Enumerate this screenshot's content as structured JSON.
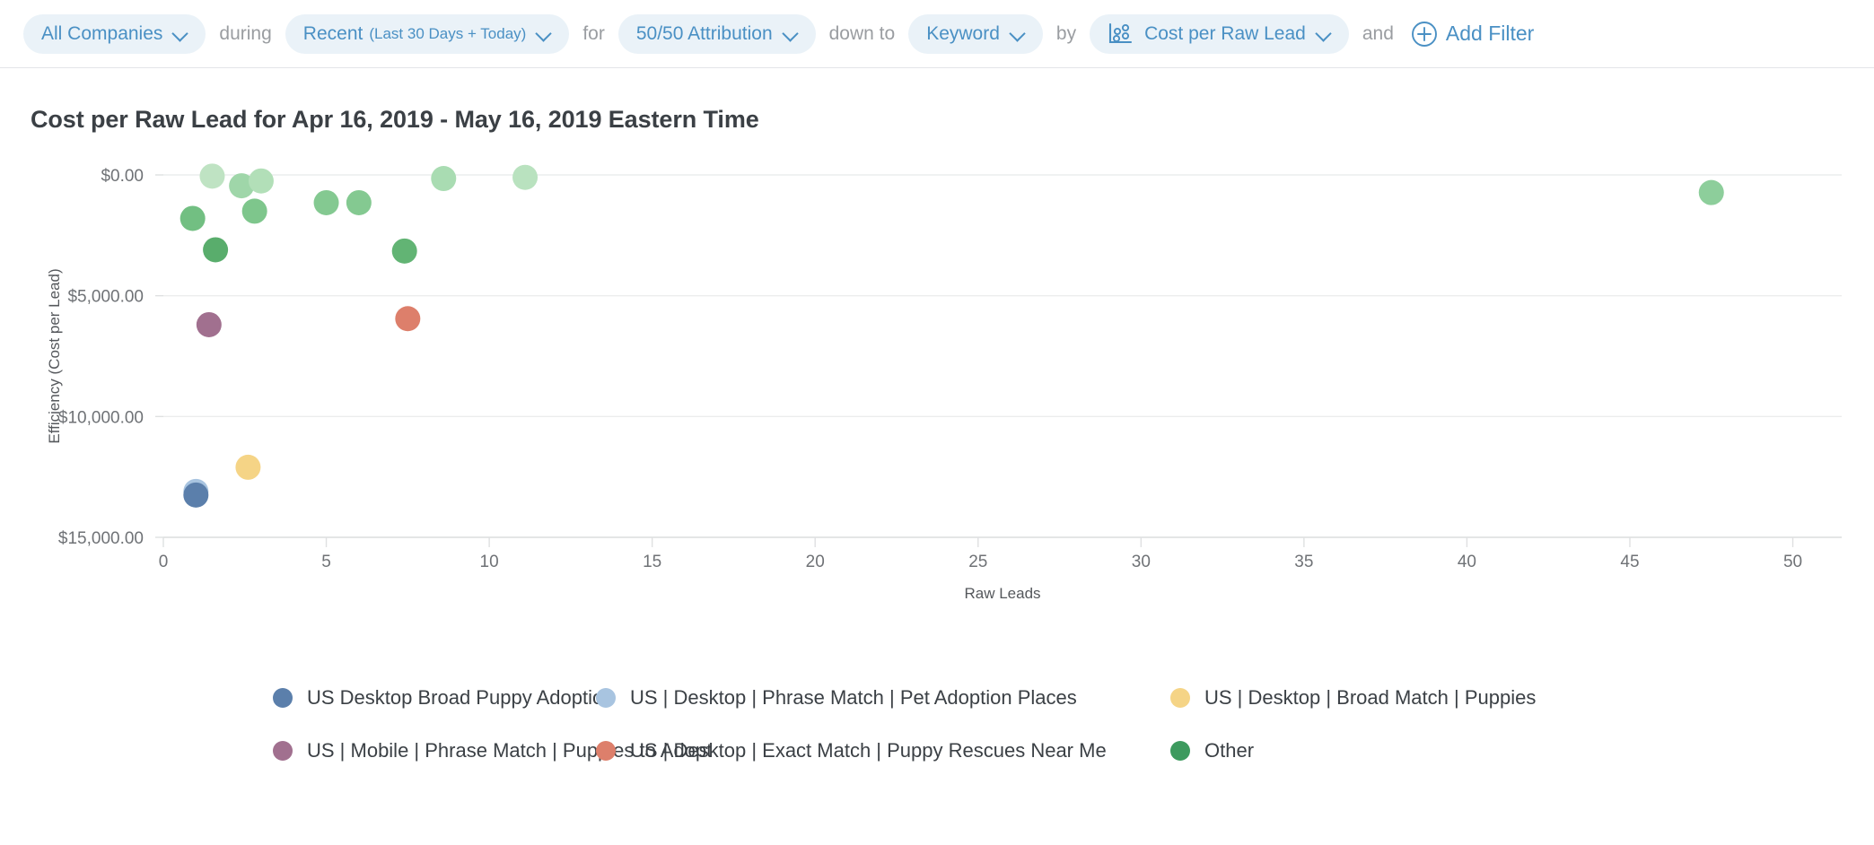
{
  "toolbar": {
    "segments": [
      {
        "type": "pill",
        "name": "company-filter",
        "label": "All Companies",
        "sub": "",
        "icon": "chevron-down-icon"
      },
      {
        "type": "conj",
        "name": "conj-during",
        "label": "during"
      },
      {
        "type": "pill",
        "name": "date-range-filter",
        "label": "Recent",
        "sub": "(Last 30 Days + Today)",
        "icon": "chevron-down-icon"
      },
      {
        "type": "conj",
        "name": "conj-for",
        "label": "for"
      },
      {
        "type": "pill",
        "name": "attribution-filter",
        "label": "50/50 Attribution",
        "sub": "",
        "icon": "chevron-down-icon"
      },
      {
        "type": "conj",
        "name": "conj-down-to",
        "label": "down to"
      },
      {
        "type": "pill",
        "name": "dimension-filter",
        "label": "Keyword",
        "sub": "",
        "icon": "chevron-down-icon"
      },
      {
        "type": "conj",
        "name": "conj-by",
        "label": "by"
      },
      {
        "type": "pill",
        "name": "metric-filter",
        "label": "Cost per Raw Lead",
        "sub": "",
        "icon": "scatter-plot-icon"
      },
      {
        "type": "conj",
        "name": "conj-and",
        "label": "and"
      }
    ],
    "add_filter_label": "Add Filter",
    "add_filter_icon": "plus-circle-icon",
    "accent": "#4a90c4",
    "pill_bg": "#eaf2f8",
    "conj_color": "#9a9da1"
  },
  "chart_data": {
    "type": "scatter",
    "title": "Cost per Raw Lead for Apr 16, 2019 - May 16, 2019 Eastern Time",
    "xlabel": "Raw Leads",
    "ylabel": "Efficiency (Cost per Lead)",
    "xlim": [
      0,
      51.5
    ],
    "ylim": [
      0,
      15000
    ],
    "y_inverted": true,
    "grid": true,
    "legend_position": "bottom",
    "x_ticks": [
      0,
      5,
      10,
      15,
      20,
      25,
      30,
      35,
      40,
      45,
      50
    ],
    "x_tick_labels": [
      "0",
      "5",
      "10",
      "15",
      "20",
      "25",
      "30",
      "35",
      "40",
      "45",
      "50"
    ],
    "y_ticks": [
      0,
      5000,
      10000,
      15000
    ],
    "y_tick_labels": [
      "$0.00",
      "$5,000.00",
      "$10,000.00",
      "$15,000.00"
    ],
    "series": [
      {
        "name": "US Desktop Broad Puppy Adoption",
        "color": "#5b7fab",
        "points": [
          {
            "x": 1.0,
            "y": 13250
          }
        ]
      },
      {
        "name": "US | Desktop | Phrase Match | Pet Adoption Places",
        "color": "#a8c4e0",
        "points": [
          {
            "x": 1.0,
            "y": 13100
          }
        ]
      },
      {
        "name": "US | Desktop | Broad Match | Puppies",
        "color": "#f5d486",
        "points": [
          {
            "x": 2.6,
            "y": 12100
          }
        ]
      },
      {
        "name": "US | Mobile | Phrase Match | Puppies to Adopt",
        "color": "#a1708f",
        "points": [
          {
            "x": 1.4,
            "y": 6200
          }
        ]
      },
      {
        "name": "US | Desktop | Exact Match | Puppy Rescues Near Me",
        "color": "#dd7f6b",
        "points": [
          {
            "x": 7.5,
            "y": 5950
          }
        ]
      },
      {
        "name": "Other",
        "color": "#3d9a5e",
        "points": [
          {
            "x": 1.5,
            "y": 50,
            "shade": "#bfe3c3"
          },
          {
            "x": 2.4,
            "y": 450,
            "shade": "#9fd6a9"
          },
          {
            "x": 3.0,
            "y": 250,
            "shade": "#b2dfb8"
          },
          {
            "x": 8.6,
            "y": 150,
            "shade": "#a9dcb2"
          },
          {
            "x": 11.1,
            "y": 100,
            "shade": "#b9e2bf"
          },
          {
            "x": 47.5,
            "y": 730,
            "shade": "#8dce9b"
          },
          {
            "x": 5.0,
            "y": 1150,
            "shade": "#84c991"
          },
          {
            "x": 6.0,
            "y": 1150,
            "shade": "#84c991"
          },
          {
            "x": 2.8,
            "y": 1500,
            "shade": "#7ec68c"
          },
          {
            "x": 0.9,
            "y": 1800,
            "shade": "#72bf82"
          },
          {
            "x": 1.6,
            "y": 3100,
            "shade": "#59ad6c"
          },
          {
            "x": 7.4,
            "y": 3150,
            "shade": "#62b474"
          }
        ]
      }
    ]
  },
  "legend": [
    {
      "name": "legend-us-desktop-broad-puppy-adoption",
      "label": "US Desktop Broad Puppy Adoption",
      "color": "#5b7fab"
    },
    {
      "name": "legend-us-desktop-phrase-pet-adoption-places",
      "label": "US | Desktop | Phrase Match | Pet Adoption Places",
      "color": "#a8c4e0"
    },
    {
      "name": "legend-us-desktop-broad-puppies",
      "label": "US | Desktop | Broad Match | Puppies",
      "color": "#f5d486"
    },
    {
      "name": "legend-us-mobile-phrase-puppies-to-adopt",
      "label": "US | Mobile | Phrase Match | Puppies to Adopt",
      "color": "#a1708f"
    },
    {
      "name": "legend-us-desktop-exact-puppy-rescues-near-me",
      "label": "US | Desktop | Exact Match | Puppy Rescues Near Me",
      "color": "#dd7f6b"
    },
    {
      "name": "legend-other",
      "label": "Other",
      "color": "#3d9a5e"
    }
  ]
}
